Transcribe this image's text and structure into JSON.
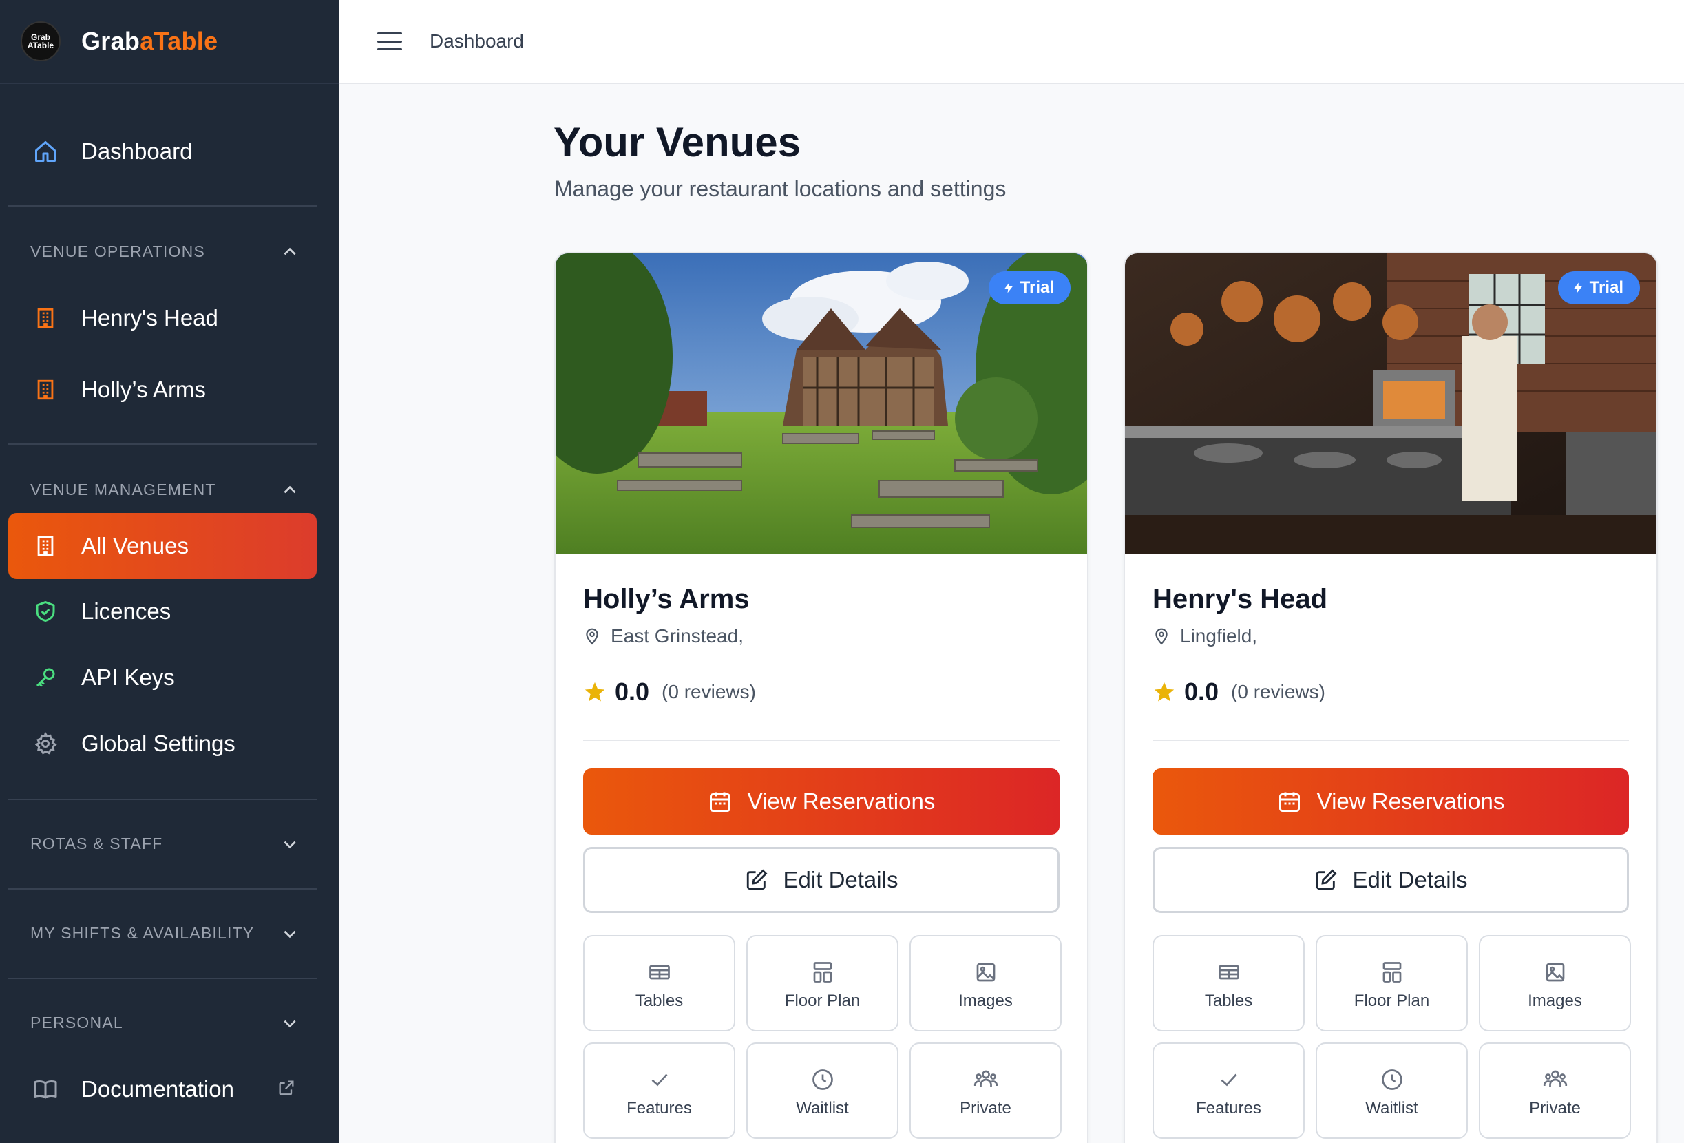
{
  "brand": {
    "logo_line1": "Grab",
    "logo_line2": "ATable",
    "name_part1": "Grab",
    "name_part2": "aTable"
  },
  "topbar": {
    "title": "Dashboard"
  },
  "sidebar": {
    "dashboard": "Dashboard",
    "venue_operations": {
      "label": "VENUE OPERATIONS",
      "items": [
        "Henry's Head",
        "Holly’s Arms"
      ]
    },
    "venue_management": {
      "label": "VENUE MANAGEMENT",
      "items": [
        "All Venues",
        "Licences",
        "API Keys",
        "Global Settings"
      ]
    },
    "rotas_staff": "ROTAS & STAFF",
    "my_shifts": "MY SHIFTS & AVAILABILITY",
    "personal": "PERSONAL",
    "documentation": "Documentation"
  },
  "main": {
    "title": "Your Venues",
    "subtitle": "Manage your restaurant locations and settings"
  },
  "venues": [
    {
      "name": "Holly’s Arms",
      "location": "East Grinstead,",
      "rating": "0.0",
      "reviews": "(0 reviews)",
      "badge": "Trial",
      "view_reservations": "View Reservations",
      "edit_details": "Edit Details",
      "tiles": [
        "Tables",
        "Floor Plan",
        "Images",
        "Features",
        "Waitlist",
        "Private"
      ]
    },
    {
      "name": "Henry's Head",
      "location": "Lingfield,",
      "rating": "0.0",
      "reviews": "(0 reviews)",
      "badge": "Trial",
      "view_reservations": "View Reservations",
      "edit_details": "Edit Details",
      "tiles": [
        "Tables",
        "Floor Plan",
        "Images",
        "Features",
        "Waitlist",
        "Private"
      ]
    }
  ],
  "colors": {
    "sidebar_bg": "#1f2937",
    "accent": "#ea580c",
    "badge": "#3b82f6",
    "star": "#eab308"
  },
  "icons": [
    "home-icon",
    "building-icon",
    "shield-icon",
    "key-icon",
    "gear-icon",
    "book-icon",
    "external-link-icon",
    "chevron-up-icon",
    "chevron-down-icon",
    "menu-icon",
    "map-pin-icon",
    "star-icon",
    "calendar-icon",
    "edit-icon",
    "table-icon",
    "floor-plan-icon",
    "image-icon",
    "check-icon",
    "clock-icon",
    "users-icon",
    "lightning-icon"
  ]
}
